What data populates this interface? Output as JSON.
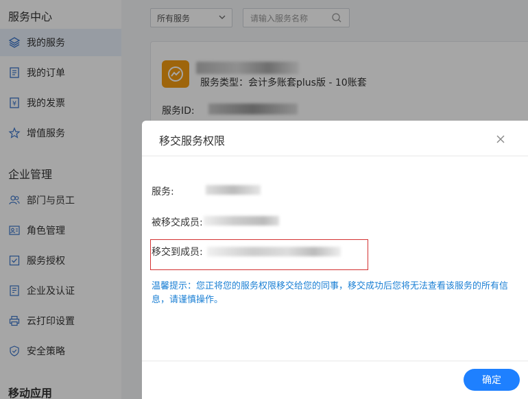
{
  "sidebar": {
    "section_service": "服务中心",
    "service_items": [
      {
        "label": "我的服务",
        "icon": "layers-icon"
      },
      {
        "label": "我的订单",
        "icon": "document-icon"
      },
      {
        "label": "我的发票",
        "icon": "yen-invoice-icon"
      },
      {
        "label": "增值服务",
        "icon": "star-icon"
      }
    ],
    "section_enterprise": "企业管理",
    "enterprise_items": [
      {
        "label": "部门与员工",
        "icon": "users-icon"
      },
      {
        "label": "角色管理",
        "icon": "id-card-icon"
      },
      {
        "label": "服务授权",
        "icon": "check-square-icon"
      },
      {
        "label": "企业及认证",
        "icon": "certificate-icon"
      },
      {
        "label": "云打印设置",
        "icon": "printer-icon"
      },
      {
        "label": "安全策略",
        "icon": "shield-icon"
      }
    ],
    "section_mobile": "移动应用"
  },
  "filters": {
    "service_select_value": "所有服务",
    "search_placeholder": "请输入服务名称"
  },
  "service_card": {
    "type_text": "服务类型：会计多账套plus版 - 10账套",
    "id_label": "服务ID:"
  },
  "dialog": {
    "title": "移交服务权限",
    "service_label": "服务:",
    "from_label": "被移交成员:",
    "to_label": "移交到成员:",
    "warning": "温馨提示：您正将您的服务权限移交给您的同事，移交成功后您将无法查看该服务的所有信息，请谨慎操作。",
    "confirm_label": "确定"
  },
  "colors": {
    "accent": "#1e80ff",
    "warning_text": "#1a7fd4",
    "highlight_border": "#d32f2f",
    "logo_bg": "#f39c12"
  }
}
